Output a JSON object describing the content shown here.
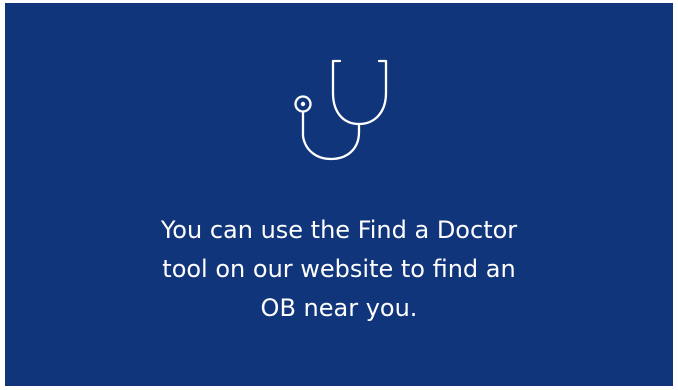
{
  "card": {
    "background_color": "#11357a",
    "icon": "stethoscope-icon",
    "message_lines": [
      "You can use the Find a Doctor",
      "tool on our website to find an",
      "OB near you."
    ],
    "text_color": "#ffffff"
  }
}
